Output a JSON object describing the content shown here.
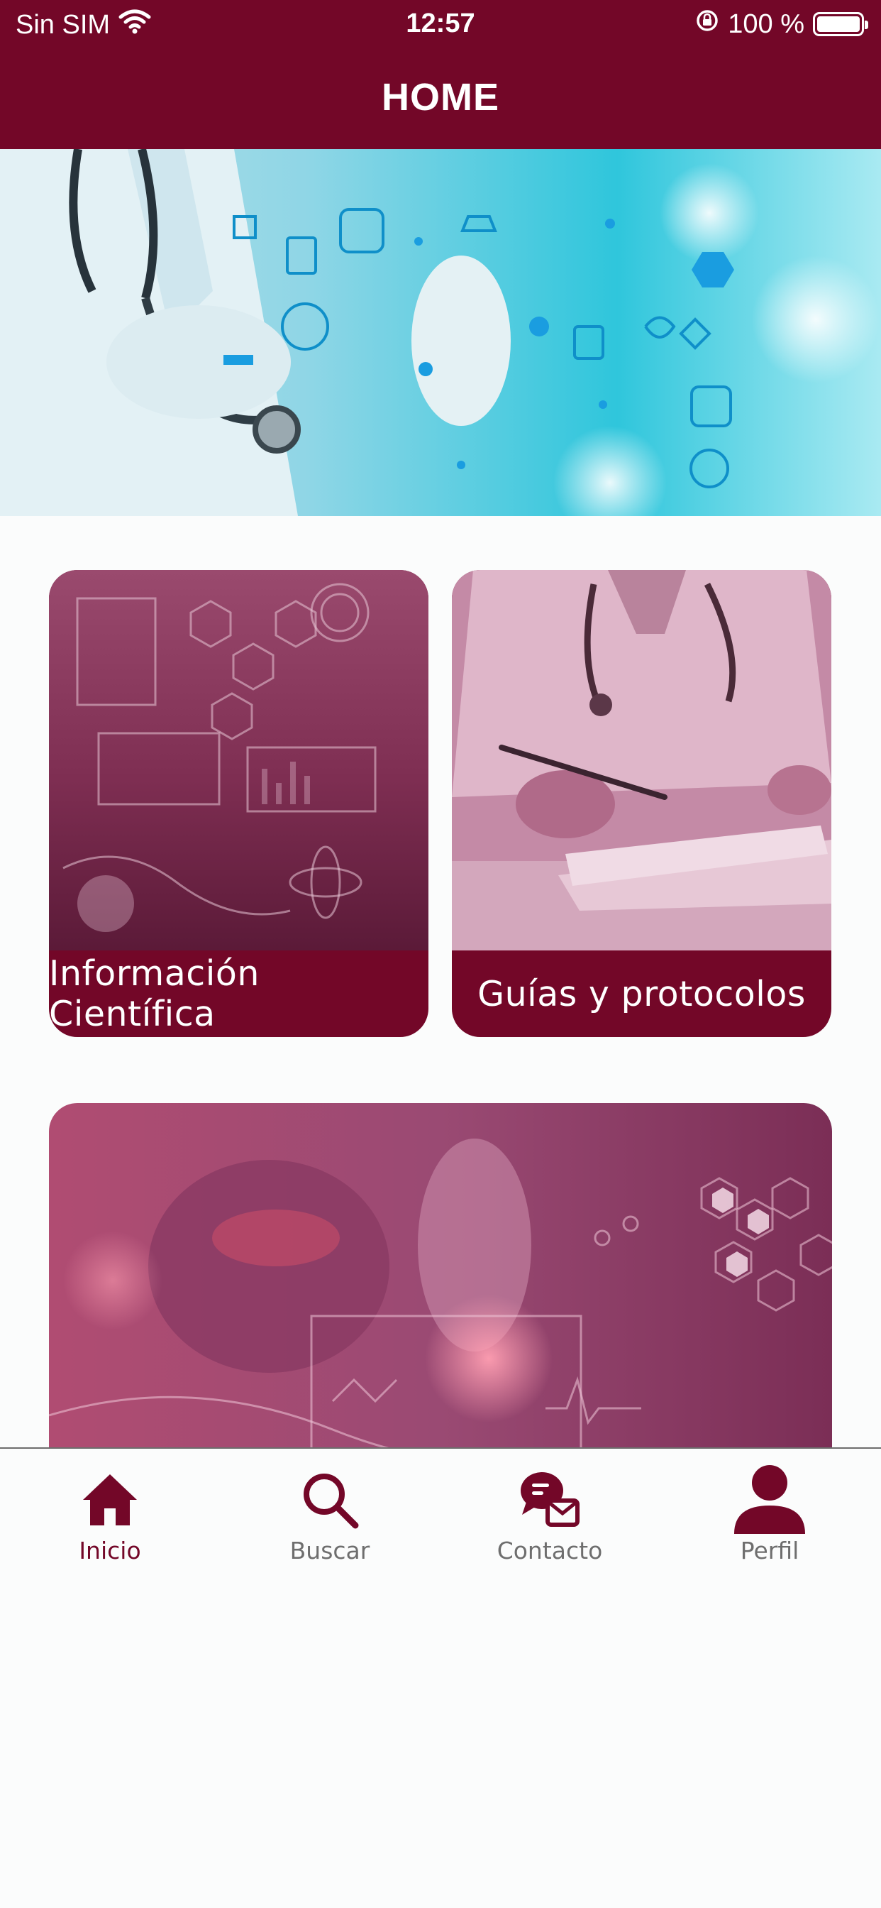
{
  "status_bar": {
    "carrier": "Sin SIM",
    "time": "12:57",
    "battery": "100 %",
    "battery_level": 1.0
  },
  "header": {
    "title": "HOME"
  },
  "hero": {
    "icon": "medical-technology-banner"
  },
  "cards": [
    {
      "label": "Información Científica",
      "icon": "science-tech-image"
    },
    {
      "label": "Guías y protocolos",
      "icon": "doctor-writing-image"
    }
  ],
  "banner": {
    "icon": "medical-tech-hand-image"
  },
  "tabbar": {
    "tabs": [
      {
        "label": "Inicio",
        "icon": "home-icon",
        "active": true
      },
      {
        "label": "Buscar",
        "icon": "search-icon",
        "active": false
      },
      {
        "label": "Contacto",
        "icon": "chat-mail-icon",
        "active": false
      },
      {
        "label": "Perfil",
        "icon": "user-icon",
        "active": false
      }
    ]
  },
  "colors": {
    "brand": "#730728",
    "background": "#fbfcfc",
    "inactive": "#6e6e6e"
  }
}
